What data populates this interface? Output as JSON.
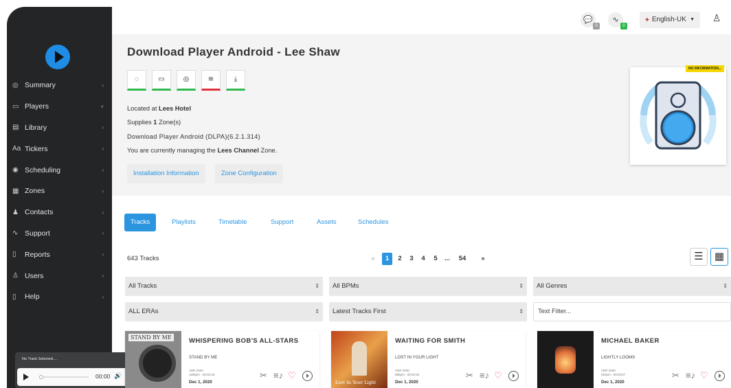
{
  "sidebar": {
    "items": [
      {
        "label": "Summary",
        "icon": "summary-icon",
        "glyph": "◎",
        "chev": "›"
      },
      {
        "label": "Players",
        "icon": "players-icon",
        "glyph": "▭",
        "chev": "˅"
      },
      {
        "label": "Library",
        "icon": "library-icon",
        "glyph": "▤",
        "chev": "›"
      },
      {
        "label": "Tickers",
        "icon": "tickers-icon",
        "glyph": "Aa",
        "chev": "›"
      },
      {
        "label": "Scheduling",
        "icon": "scheduling-icon",
        "glyph": "◉",
        "chev": "›"
      },
      {
        "label": "Zones",
        "icon": "zones-icon",
        "glyph": "▦",
        "chev": "›"
      },
      {
        "label": "Contacts",
        "icon": "contacts-icon",
        "glyph": "♟",
        "chev": "›"
      },
      {
        "label": "Support",
        "icon": "support-icon",
        "glyph": "∿",
        "chev": "›"
      },
      {
        "label": "Reports",
        "icon": "reports-icon",
        "glyph": "▯",
        "chev": "›"
      },
      {
        "label": "Users",
        "icon": "users-icon",
        "glyph": "♙",
        "chev": "›"
      },
      {
        "label": "Help",
        "icon": "help-icon",
        "glyph": "▯",
        "chev": "›"
      }
    ]
  },
  "player": {
    "no_track": "No Track Selected....",
    "time": "00:00",
    "progress": 0,
    "volume": 0.8
  },
  "topbar": {
    "messages_count": "0",
    "activity_count": "0",
    "language": "English-UK",
    "colors": {
      "messages_badge": "#9e9e9e",
      "activity_badge": "#2db84c"
    }
  },
  "header": {
    "title": "Download Player Android - Lee Shaw",
    "location_prefix": "Located at",
    "location": "Lees Hotel",
    "supplies_prefix": "Supplies",
    "zones_count": "1",
    "supplies_suffix": "Zone(s)",
    "player_type": "Download Player Android (DLPA)(6.2.1.314)",
    "managing_prefix": "You are currently managing the",
    "channel": "Lees Channel",
    "managing_suffix": "Zone.",
    "btn_install": "Installation Information",
    "btn_zone": "Zone Configuration",
    "no_info": "NO INFORMATION...",
    "status_icons": [
      "power-icon",
      "battery-icon",
      "camera-icon",
      "wifi-icon",
      "download-icon"
    ],
    "status_colors": [
      "#2db84c",
      "#2db84c",
      "#2db84c",
      "#e0303c",
      "#2db84c"
    ]
  },
  "tabs": [
    "Tracks",
    "Playlists",
    "Timetable",
    "Support",
    "Assets",
    "Schedules"
  ],
  "library": {
    "count": "643 Tracks",
    "pages": [
      "«",
      "1",
      "2",
      "3",
      "4",
      "5",
      "...",
      "54",
      "»"
    ],
    "current_page": "1",
    "filters": {
      "tracks": "All Tracks",
      "bpms": "All BPMs",
      "genres": "All Genres",
      "eras": "ALL ERAs",
      "sort": "Latest Tracks First",
      "text_placeholder": "Text Filter..."
    }
  },
  "cards": [
    {
      "title": "WHISPERING BOB'S ALL-STARS",
      "album": "STAND BY ME",
      "meta1": "ADR 2020",
      "meta2": "118bpm - 00:03:33",
      "date": "Dec 1, 2020",
      "art_text": "STAND BY ME",
      "art_color": "#8a8a8a"
    },
    {
      "title": "WAITING FOR SMITH",
      "album": "LOST IN YOUR LIGHT",
      "meta1": "ADR 2020",
      "meta2": "88bpm - 00:03:32",
      "date": "Dec 1, 2020",
      "art_text": "Lost In Your Light",
      "art_color": "#b5651d"
    },
    {
      "title": "MICHAEL BAKER",
      "album": "LIGHTLY LOOMS",
      "meta1": "ADR 2020",
      "meta2": "81bpm - 00:03:57",
      "date": "Dec 1, 2020",
      "art_text": "",
      "art_color": "#1a1a1a"
    }
  ]
}
